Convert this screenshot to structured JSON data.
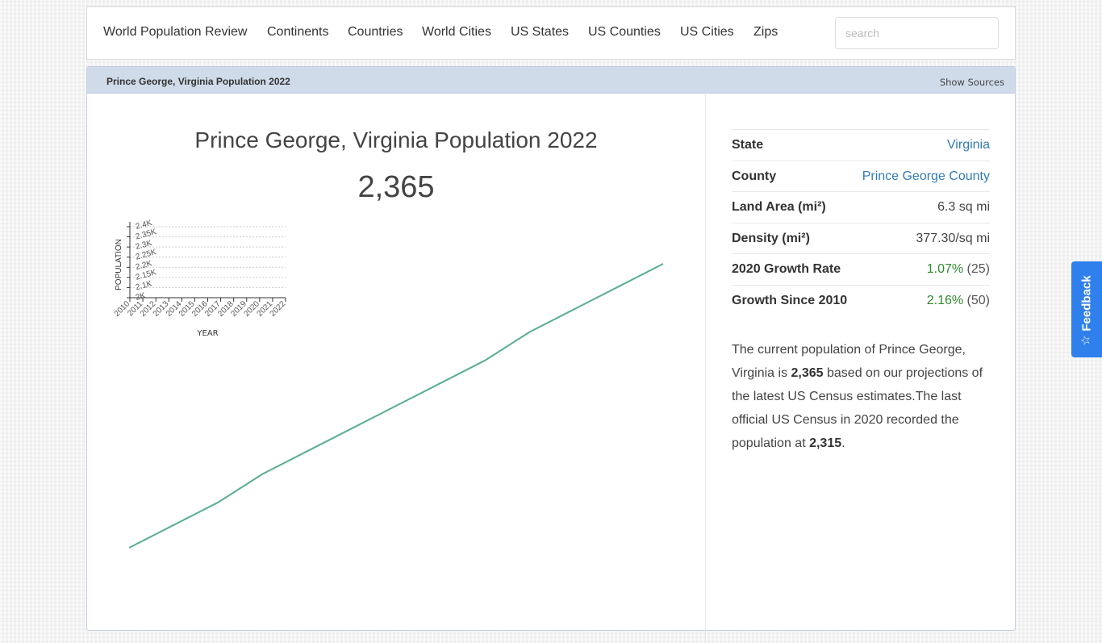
{
  "nav": {
    "brand": "World Population Review",
    "items": [
      "Continents",
      "Countries",
      "World Cities",
      "US States",
      "US Counties",
      "US Cities",
      "Zips"
    ],
    "search_placeholder": "search"
  },
  "panel": {
    "heading": "Prince George, Virginia Population 2022",
    "show_sources": "Show Sources"
  },
  "main": {
    "title": "Prince George, Virginia Population 2022",
    "population": "2,365"
  },
  "facts": [
    {
      "label": "State",
      "value": "Virginia",
      "link": true
    },
    {
      "label": "County",
      "value": "Prince George County",
      "link": true
    },
    {
      "label": "Land Area (mi²)",
      "value": "6.3 sq mi"
    },
    {
      "label": "Density (mi²)",
      "value": "377.30/sq mi"
    },
    {
      "label": "2020 Growth Rate",
      "value": "1.07%",
      "extra": "(25)"
    },
    {
      "label": "Growth Since 2010",
      "value": "2.16%",
      "extra": "(50)"
    }
  ],
  "description": {
    "p1": "The current population of Prince George, Virginia is ",
    "current": "2,365",
    "p2": " based on our projections of the latest US Census estimates.The last official US Census in 2020 recorded the population at ",
    "census": "2,315",
    "p3": "."
  },
  "feedback": {
    "label": "Feedback",
    "icon": "star-sparkle-icon"
  },
  "colors": {
    "line": "#5aae8f",
    "link": "#337ab7",
    "growth": "#2e8b2e",
    "feedback": "#2f80ed",
    "panel_heading": "#cfdbe9"
  },
  "chart_data": {
    "type": "line",
    "title": "",
    "xlabel": "YEAR",
    "ylabel": "POPULATION",
    "x": [
      2010,
      2011,
      2012,
      2013,
      2014,
      2015,
      2016,
      2017,
      2018,
      2019,
      2020,
      2021,
      2022
    ],
    "x_tick_labels": [
      "2010",
      "2011",
      "2012",
      "2013",
      "2014",
      "2015",
      "2016",
      "2017",
      "2018",
      "2019",
      "2020",
      "2021",
      "2022"
    ],
    "y_tick_labels": [
      "2K",
      "2.1K",
      "2.15K",
      "2.2K",
      "2.25K",
      "2.3K",
      "2.35K",
      "2.4K"
    ],
    "y_ticks": [
      2000,
      2100,
      2150,
      2200,
      2250,
      2300,
      2350,
      2400
    ],
    "ylim": [
      2000,
      2400
    ],
    "grid": true,
    "series": [
      {
        "name": "Population",
        "values": [
          2315,
          2319,
          2323,
          2328,
          2332,
          2336,
          2340,
          2344,
          2348,
          2353,
          2357,
          2361,
          2365
        ]
      }
    ]
  }
}
